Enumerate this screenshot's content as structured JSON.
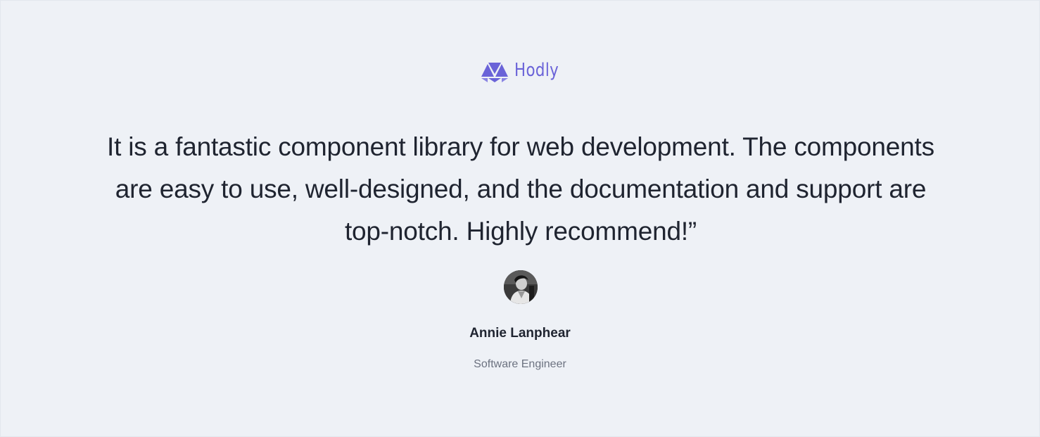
{
  "brand": {
    "name": "Hodly",
    "logo_icon": "triangle-mosaic-icon",
    "color": "#6a63d8"
  },
  "testimonial": {
    "quote": "It is a fantastic component library for web development. The components are easy to use, well-designed, and the documentation and support are top-notch. Highly recommend!”",
    "author": {
      "name": "Annie Lanphear",
      "role": "Software Engineer",
      "avatar_icon": "avatar-photo"
    }
  },
  "colors": {
    "background": "#eef1f6",
    "text": "#1f2430",
    "muted": "#6c7280"
  }
}
